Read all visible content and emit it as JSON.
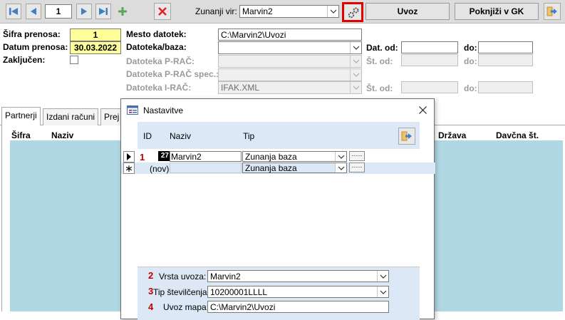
{
  "toolbar": {
    "record_number": "1",
    "ext_source_label": "Zunanji vir:",
    "ext_source_value": "Marvin2",
    "uvoz_label": "Uvoz",
    "poknjizi_label": "Poknjiži v GK"
  },
  "form": {
    "sifra_label": "Šifra prenosa:",
    "sifra_value": "1",
    "datum_label": "Datum prenosa:",
    "datum_value": "30.03.2022",
    "zakljucen_label": "Zaključen:",
    "mesto_label": "Mesto datotek:",
    "mesto_value": "C:\\Marvin2\\Uvozi",
    "datoteka_baza_label": "Datoteka/baza:",
    "datoteka_prac_label": "Datoteka P-RAČ:",
    "datoteka_prac_spec_label": "Datoteka P-RAČ spec.:",
    "datoteka_irac_label": "Datoteka I-RAČ:",
    "datoteka_irac_value": "IFAK.XML",
    "dat_od_label": "Dat. od:",
    "do_label": "do:",
    "st_od_label": "Št. od:"
  },
  "tabs": [
    "Partnerji",
    "Izdani računi",
    "Prej"
  ],
  "table_headers": {
    "sifra": "Šifra",
    "naziv": "Naziv",
    "drzava": "Država",
    "davcna": "Davčna št."
  },
  "dialog": {
    "title": "Nastavitve",
    "columns": [
      "ID",
      "Naziv",
      "Tip"
    ],
    "rows": [
      {
        "marker": "1",
        "id": "27",
        "naziv": "Marvin2",
        "tip": "Zunanja baza"
      },
      {
        "marker": "",
        "id": "(nov)",
        "naziv": "",
        "tip": "Zunanja baza"
      }
    ],
    "ellipsis": "·····",
    "details": [
      {
        "num": "2",
        "label": "Vrsta uvoza:",
        "value": "Marvin2"
      },
      {
        "num": "3",
        "label": "Tip številčenja:",
        "value": "10200001LLLL"
      },
      {
        "num": "4",
        "label": "Uvoz mapa:",
        "value": "C:\\Marvin2\\Uvozi"
      }
    ]
  },
  "colors": {
    "accent_yellow": "#ffff99",
    "highlight_red": "#e00000",
    "nav_blue": "#3f7fc4",
    "add_green": "#5aa75a",
    "grid_blue": "#b0d8e4"
  }
}
